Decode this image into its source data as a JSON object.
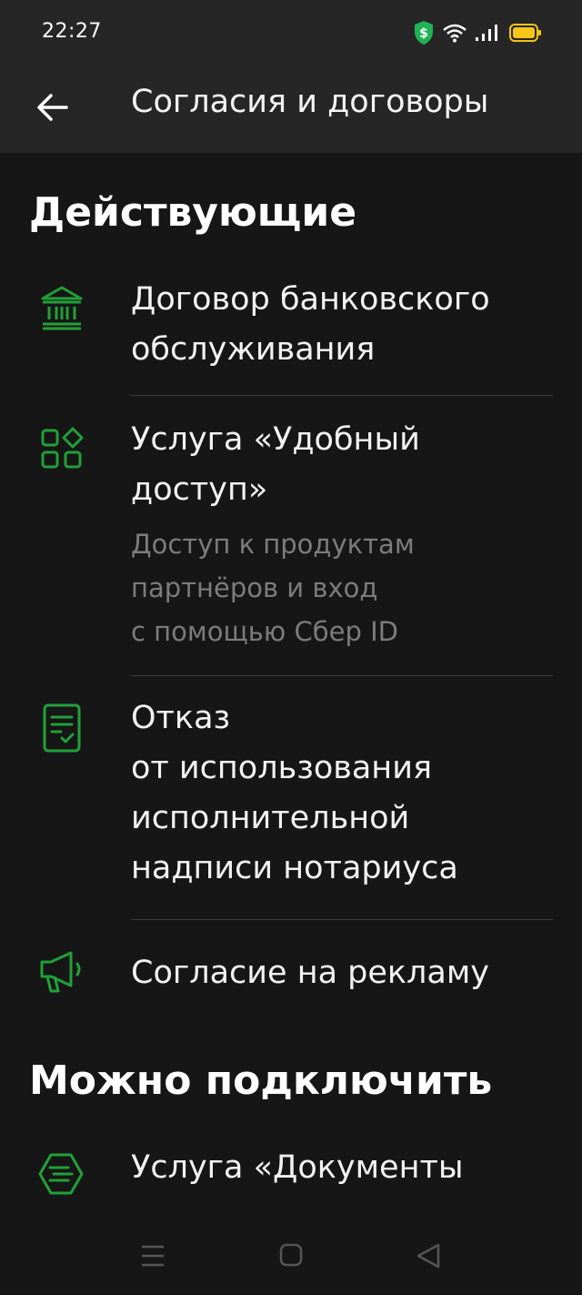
{
  "status_bar": {
    "time": "22:27",
    "icons": [
      "shield-dollar-icon",
      "wifi-icon",
      "signal-icon",
      "battery-icon"
    ]
  },
  "app_bar": {
    "back_icon": "arrow-left-icon",
    "title": "Согласия и договоры"
  },
  "sections": [
    {
      "title": "Действующие",
      "items": [
        {
          "icon": "bank-icon",
          "title": "Договор банковского\nобслуживания"
        },
        {
          "icon": "apps-grid-icon",
          "title": "Услуга «Удобный\nдоступ»",
          "subtitle": "Доступ к продуктам\nпартнёров и вход\nс помощью Сбер ID"
        },
        {
          "icon": "document-check-icon",
          "title": "Отказ\nот использования\nисполнительной\nнадписи нотариуса"
        },
        {
          "icon": "megaphone-icon",
          "title": "Согласие на рекламу"
        }
      ]
    },
    {
      "title": "Можно подключить",
      "items": [
        {
          "icon": "document-fast-icon",
          "title": "Услуга «Документы"
        }
      ]
    }
  ],
  "colors": {
    "accent": "#21a038",
    "background": "#161616",
    "app_bar": "#262626",
    "secondary_text": "#7c7c7c",
    "battery": "#f5c518"
  },
  "nav_bar": {
    "icons": [
      "menu-icon",
      "home-icon",
      "back-triangle-icon"
    ]
  }
}
